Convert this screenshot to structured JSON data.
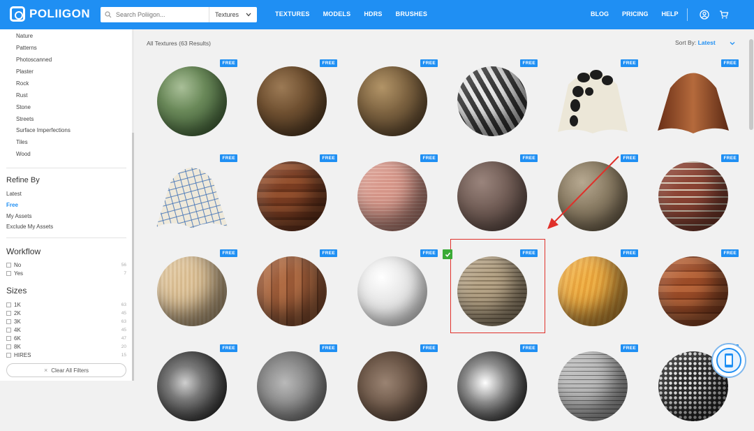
{
  "header": {
    "logo_text": "POLIIGON",
    "search_placeholder": "Search Poliigon...",
    "search_category": "Textures",
    "nav_left": [
      "TEXTURES",
      "MODELS",
      "HDRS",
      "BRUSHES"
    ],
    "nav_right": [
      "BLOG",
      "PRICING",
      "HELP"
    ]
  },
  "sidebar": {
    "categories": [
      "Nature",
      "Patterns",
      "Photoscanned",
      "Plaster",
      "Rock",
      "Rust",
      "Stone",
      "Streets",
      "Surface Imperfections",
      "Tiles",
      "Wood"
    ],
    "refine_title": "Refine By",
    "refine_items": [
      {
        "label": "Latest",
        "active": false
      },
      {
        "label": "Free",
        "active": true
      },
      {
        "label": "My Assets",
        "active": false
      },
      {
        "label": "Exclude My Assets",
        "active": false
      }
    ],
    "workflow_title": "Workflow",
    "workflow_items": [
      {
        "label": "No",
        "count": "56"
      },
      {
        "label": "Yes",
        "count": "7"
      }
    ],
    "sizes_title": "Sizes",
    "size_items": [
      {
        "label": "1K",
        "count": "63"
      },
      {
        "label": "2K",
        "count": "45"
      },
      {
        "label": "3K",
        "count": "63"
      },
      {
        "label": "4K",
        "count": "45"
      },
      {
        "label": "6K",
        "count": "47"
      },
      {
        "label": "8K",
        "count": "20"
      },
      {
        "label": "HIRES",
        "count": "15"
      }
    ],
    "clear_all": "Clear All Filters"
  },
  "main": {
    "results_title": "All Textures (63 Results)",
    "sort_label": "Sort By:",
    "sort_value": "Latest",
    "badge": "FREE",
    "rows": [
      [
        {
          "name": "green-tiles",
          "bg": "radial-gradient(circle at 35% 30%, #a9bf98 0%, #6b8a5a 35%, #3d5a34 80%, #2a3f24 100%)",
          "free": true
        },
        {
          "name": "soil",
          "bg": "radial-gradient(circle at 35% 30%, #9c7a55 0%, #6e4f30 40%, #43301d 85%, #2c1f12 100%)",
          "free": true
        },
        {
          "name": "gravel-soil",
          "bg": "radial-gradient(circle at 35% 30%, #b29467 0%, #7c6240 40%, #4f3c26 85%, #332617 100%)",
          "free": true
        },
        {
          "name": "herringbone",
          "bg": "repeating-linear-gradient(60deg,#3a3a3a 0 7px,#e8e8e8 7px 13px),#888",
          "free": true,
          "shade": true
        },
        {
          "name": "fabric-pattern",
          "drape": "pattern",
          "free": true
        },
        {
          "name": "leather-drape",
          "drape": "leather",
          "free": true
        }
      ],
      [
        {
          "name": "fabric-grid",
          "drape": "grid",
          "free": true
        },
        {
          "name": "wood-planks",
          "bg": "repeating-linear-gradient(0deg,#7b3d22 0 8px,#94502e 8px 16px,#6a341c 16px 20px)",
          "free": true,
          "shade": true
        },
        {
          "name": "pink-bricks",
          "bg": "repeating-linear-gradient(0deg,#d7978a 0 4px,#e8b7aa 4px 5px),#d28e80",
          "free": true,
          "shade": true
        },
        {
          "name": "plaster-brown",
          "bg": "radial-gradient(circle at 35% 30%, #9a847c 0%, #6e5a53 45%, #463833 100%)",
          "free": true
        },
        {
          "name": "stone-gravel",
          "bg": "radial-gradient(circle at 35% 30%, #b7a991 0%, #8a7c64 40%, #5a4f3d 85%, #3e3629 100%)",
          "free": true
        },
        {
          "name": "red-bricks",
          "bg": "repeating-linear-gradient(0deg,#8c4434 0 8px,#d8cbb8 8px 10px),#7a3a2c",
          "free": true,
          "shade": true
        }
      ],
      [
        {
          "name": "light-wood",
          "bg": "repeating-linear-gradient(90deg,#e2c9a2 0 3px,#d7ba8e 3px 6px)",
          "free": true,
          "shade": true
        },
        {
          "name": "parquet",
          "bg": "repeating-linear-gradient(90deg,#9b5a37 0 10px,#b06c44 10px 20px,#7d4629 20px 22px)",
          "free": true,
          "shade": true
        },
        {
          "name": "marble",
          "bg": "radial-gradient(circle at 35% 30%, #ffffff 0%, #e2e2e2 45%, #a8a8a8 100%)",
          "free": true
        },
        {
          "name": "stone-wall",
          "bg": "repeating-linear-gradient(0deg,#b7a588 0 4px,#8c7b61 4px 6px),#a89678",
          "free": true,
          "shade": true
        },
        {
          "name": "yellow-wood",
          "bg": "repeating-linear-gradient(100deg,#f1b34a 0 4px,#e7a23a 4px 8px)",
          "free": true,
          "shade": true
        },
        {
          "name": "wood-floor",
          "bg": "repeating-linear-gradient(0deg,#9c4c28 0 9px,#b8653a 9px 18px,#7f3a1c 18px 20px)",
          "free": true,
          "shade": true
        }
      ],
      [
        {
          "name": "metal-dark",
          "bg": "radial-gradient(circle at 40% 45%, #cfcfcf 0%, #7a7a7a 30%, #2e2e2e 75%, #111 100%)",
          "free": true
        },
        {
          "name": "concrete-rough",
          "bg": "radial-gradient(circle at 40% 45%, #b9b9b9 0%, #8a8a8a 40%, #4d4d4d 100%)",
          "free": true
        },
        {
          "name": "rock-brown",
          "bg": "radial-gradient(circle at 40% 45%, #9a8372 0%, #6c5748 45%, #3e3028 100%)",
          "free": true
        },
        {
          "name": "chrome",
          "bg": "radial-gradient(circle at 40% 45%, #ffffff 0%, #8e8e8e 35%, #2a2a2a 80%, #0e0e0e 100%)",
          "free": true
        },
        {
          "name": "metal-tiles",
          "bg": "repeating-linear-gradient(0deg,#bdbdbd 0 5px,#6e6e6e 5px 6px),#9e9e9e",
          "free": true,
          "shade": true
        },
        {
          "name": "hex-metal",
          "bg": "radial-gradient(circle at 50% 50%, #e0e0e0 0 2px, #2a2a2a 2.5px) 0 0/7px 7px",
          "free": true,
          "shade": true
        }
      ]
    ]
  }
}
